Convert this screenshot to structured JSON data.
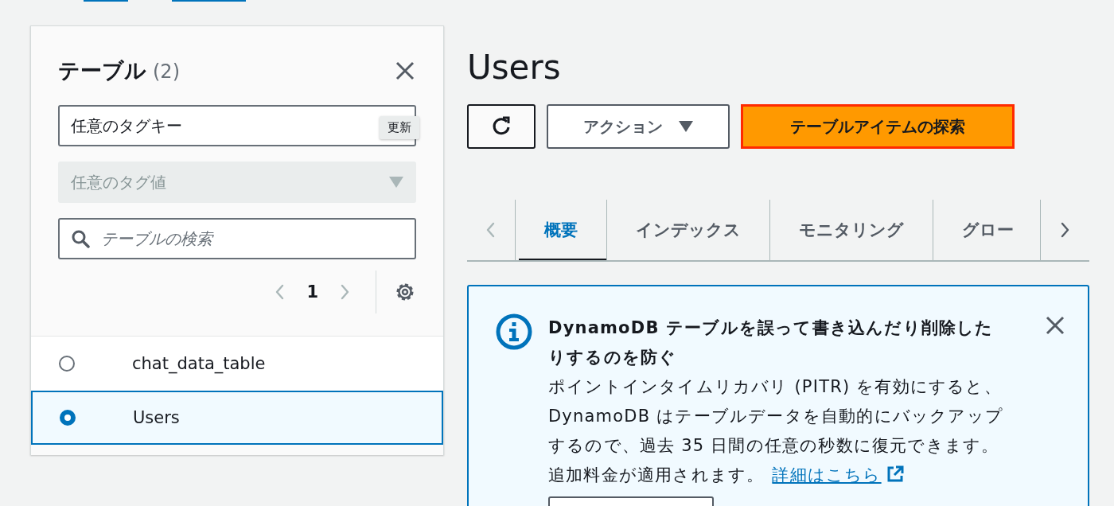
{
  "sidebar": {
    "title": "テーブル",
    "count": "(2)",
    "tag_key_field": {
      "value": "任意のタグキー"
    },
    "tooltip": "更新",
    "tag_value_select": {
      "placeholder": "任意のタグ値",
      "disabled": true
    },
    "search": {
      "placeholder": "テーブルの検索"
    },
    "pagination": {
      "page": "1",
      "prev_disabled": true,
      "next_disabled": true
    },
    "tables": [
      {
        "name": "chat_data_table",
        "selected": false
      },
      {
        "name": "Users",
        "selected": true
      }
    ]
  },
  "main": {
    "title": "Users",
    "actions_button": "アクション",
    "primary_button": "テーブルアイテムの探索",
    "tab_prev_disabled": true,
    "tab_next_disabled": false,
    "tabs": [
      {
        "label": "概要",
        "selected": true
      },
      {
        "label": "インデックス",
        "selected": false
      },
      {
        "label": "モニタリング",
        "selected": false
      },
      {
        "label": "グロー",
        "selected": false
      }
    ],
    "alert": {
      "title": "DynamoDB テーブルを誤って書き込んだり削除したりするのを防ぐ",
      "body": "ポイントインタイムリカバリ (PITR) を有効にすると、DynamoDB はテーブルデータを自動的にバックアップするので、過去 35 日間の任意の秒数に復元できます。追加料金が適用されます。",
      "link": "詳細はこちら"
    }
  }
}
